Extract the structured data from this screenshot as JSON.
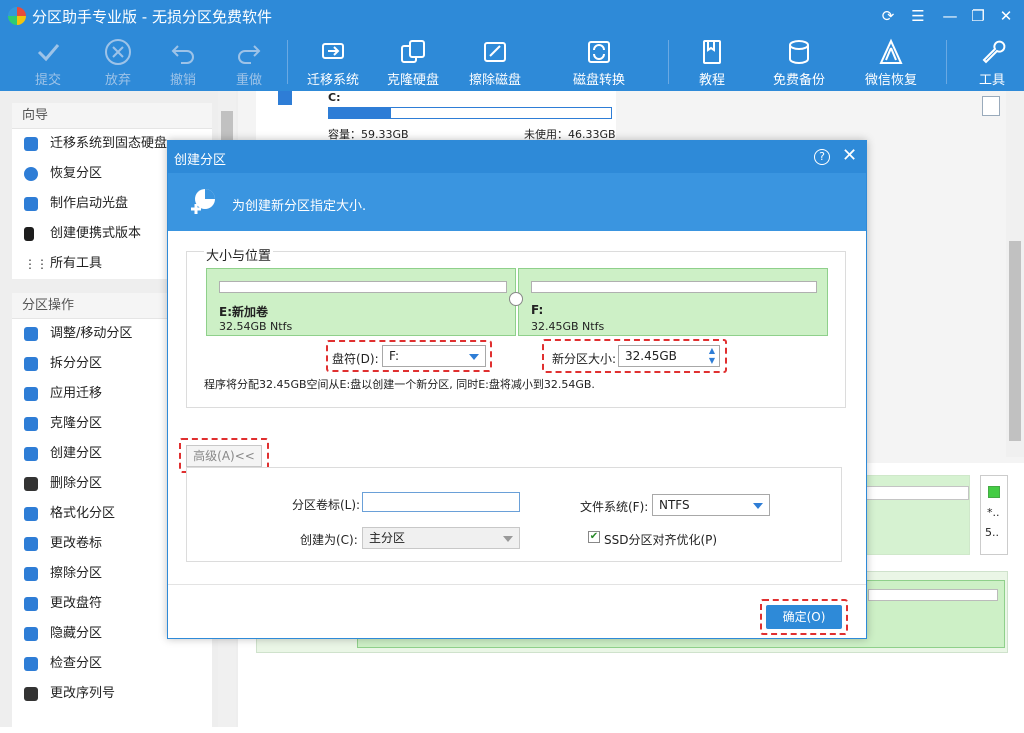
{
  "titlebar": {
    "title": "分区助手专业版 - 无损分区免费软件"
  },
  "toolbar": {
    "items": [
      {
        "label": "提交",
        "icon": "check-icon"
      },
      {
        "label": "放弃",
        "icon": "cancel-icon"
      },
      {
        "label": "撤销",
        "icon": "undo-icon"
      },
      {
        "label": "重做",
        "icon": "redo-icon"
      },
      {
        "label": "迁移系统",
        "icon": "migrate-os-icon"
      },
      {
        "label": "克隆硬盘",
        "icon": "clone-disk-icon"
      },
      {
        "label": "擦除磁盘",
        "icon": "wipe-disk-icon"
      },
      {
        "label": "磁盘转换",
        "icon": "disk-convert-icon"
      },
      {
        "label": "教程",
        "icon": "book-icon"
      },
      {
        "label": "免费备份",
        "icon": "backup-icon"
      },
      {
        "label": "微信恢复",
        "icon": "recover-icon"
      },
      {
        "label": "工具",
        "icon": "tools-icon"
      }
    ]
  },
  "sidebar": {
    "wizard_title": "向导",
    "wizard_items": [
      "迁移系统到固态硬盘",
      "恢复分区",
      "制作启动光盘",
      "创建便携式版本",
      "所有工具"
    ],
    "ops_title": "分区操作",
    "ops_items": [
      "调整/移动分区",
      "拆分分区",
      "应用迁移",
      "克隆分区",
      "创建分区",
      "删除分区",
      "格式化分区",
      "更改卷标",
      "擦除分区",
      "更改盘符",
      "隐藏分区",
      "检查分区",
      "更改序列号"
    ]
  },
  "disk_c": {
    "name": "C:",
    "capacity": "容量：59.33GB",
    "unused": "未使用：46.33GB",
    "used_fraction": 0.22
  },
  "right_card": {
    "text1": "*..",
    "text2": "5.."
  },
  "dialog": {
    "title": "创建分区",
    "banner_text": "为创建新分区指定大小.",
    "group_title": "大小与位置",
    "part_e": {
      "name": "E:新加卷",
      "size": "32.54GB Ntfs"
    },
    "part_f": {
      "name": "F:",
      "size": "32.45GB Ntfs"
    },
    "drive_letter_label": "盘符(D):",
    "drive_letter_value": "F:",
    "new_size_label": "新分区大小:",
    "new_size_value": "32.45GB",
    "info_text": "程序将分配32.45GB空间从E:盘以创建一个新分区, 同时E:盘将减小到32.54GB.",
    "advanced_button": "高级(A)<<",
    "volume_label_label": "分区卷标(L):",
    "volume_label_value": "",
    "fs_label": "文件系统(F):",
    "fs_value": "NTFS",
    "create_as_label": "创建为(C):",
    "create_as_value": "主分区",
    "ssd_label": "SSD分区对齐优化(P)",
    "ssd_checked": true,
    "ok_button": "确定(O)"
  }
}
